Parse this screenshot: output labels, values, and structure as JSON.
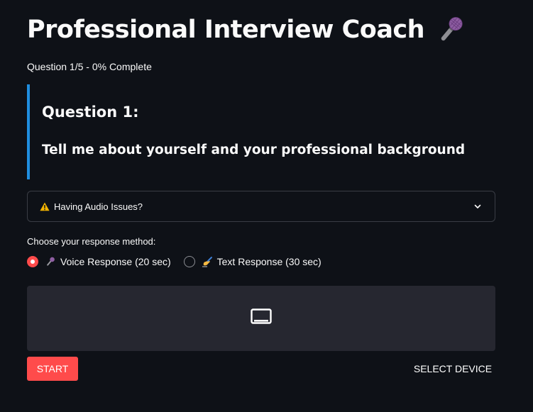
{
  "header": {
    "title": "Professional Interview Coach",
    "title_icon": "microphone-icon"
  },
  "progress": {
    "text": "Question 1/5 - 0% Complete",
    "current": 1,
    "total": 5,
    "percent": 0
  },
  "question": {
    "label": "Question 1:",
    "text": "Tell me about yourself and your professional background",
    "accent_color": "#1f8ee0"
  },
  "audio_help": {
    "label": "Having Audio Issues?",
    "icon": "warning-icon",
    "expanded": false
  },
  "response_method": {
    "caption": "Choose your response method:",
    "options": [
      {
        "label": "Voice Response (20 sec)",
        "icon": "microphone-icon",
        "selected": true
      },
      {
        "label": "Text Response (30 sec)",
        "icon": "writing-hand-icon",
        "selected": false
      }
    ]
  },
  "recorder": {
    "icon": "webcam-icon",
    "start_label": "START",
    "select_device_label": "SELECT DEVICE"
  },
  "colors": {
    "background": "#0e1117",
    "primary": "#ff4b4b",
    "panel": "#262730",
    "border": "#3a3d45"
  }
}
